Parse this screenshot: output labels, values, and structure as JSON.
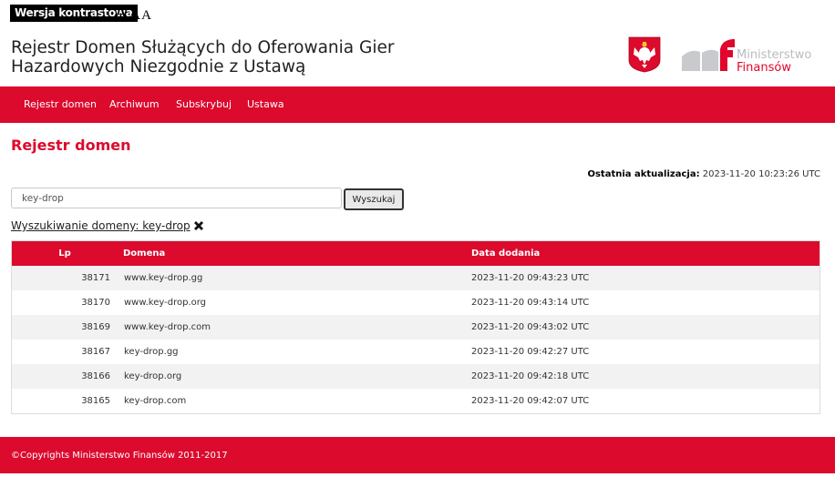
{
  "accessibility": {
    "contrast_label": "Wersja kontrastowa",
    "font_size_large": "A",
    "font_size_medium": "A",
    "font_size_small": "A"
  },
  "header": {
    "title": "Rejestr Domen Służących do Oferowania Gier Hazardowych Niezgodnie z Ustawą",
    "ministry_line1": "Ministerstwo",
    "ministry_line2": "Finansów"
  },
  "nav": {
    "items": [
      {
        "label": "Rejestr domen"
      },
      {
        "label": "Archiwum"
      },
      {
        "label": "Subskrybuj"
      },
      {
        "label": "Ustawa"
      }
    ]
  },
  "main": {
    "heading": "Rejestr domen",
    "last_update_label": "Ostatnia aktualizacja:",
    "last_update_value": "2023-11-20 10:23:26 UTC",
    "search": {
      "value": "key-drop",
      "button_label": "Wyszukaj"
    },
    "search_result_label": "Wyszukiwanie domeny: key-drop "
  },
  "table": {
    "headers": {
      "lp": "Lp",
      "domain": "Domena",
      "date": "Data dodania"
    },
    "rows": [
      {
        "lp": "38171",
        "domain": "www.key-drop.gg",
        "date": "2023-11-20 09:43:23 UTC"
      },
      {
        "lp": "38170",
        "domain": "www.key-drop.org",
        "date": "2023-11-20 09:43:14 UTC"
      },
      {
        "lp": "38169",
        "domain": "www.key-drop.com",
        "date": "2023-11-20 09:43:02 UTC"
      },
      {
        "lp": "38167",
        "domain": "key-drop.gg",
        "date": "2023-11-20 09:42:27 UTC"
      },
      {
        "lp": "38166",
        "domain": "key-drop.org",
        "date": "2023-11-20 09:42:18 UTC"
      },
      {
        "lp": "38165",
        "domain": "key-drop.com",
        "date": "2023-11-20 09:42:07 UTC"
      }
    ]
  },
  "footer": {
    "copyright": "©Copyrights Ministerstwo Finansów 2011-2017"
  },
  "colors": {
    "brand_red": "#dc0a2d",
    "row_stripe": "#f2f2f2",
    "mf_grey": "#b9bcc0"
  },
  "icons": [
    "polish-eagle-emblem-icon",
    "ministry-finance-logo-icon",
    "close-icon"
  ]
}
